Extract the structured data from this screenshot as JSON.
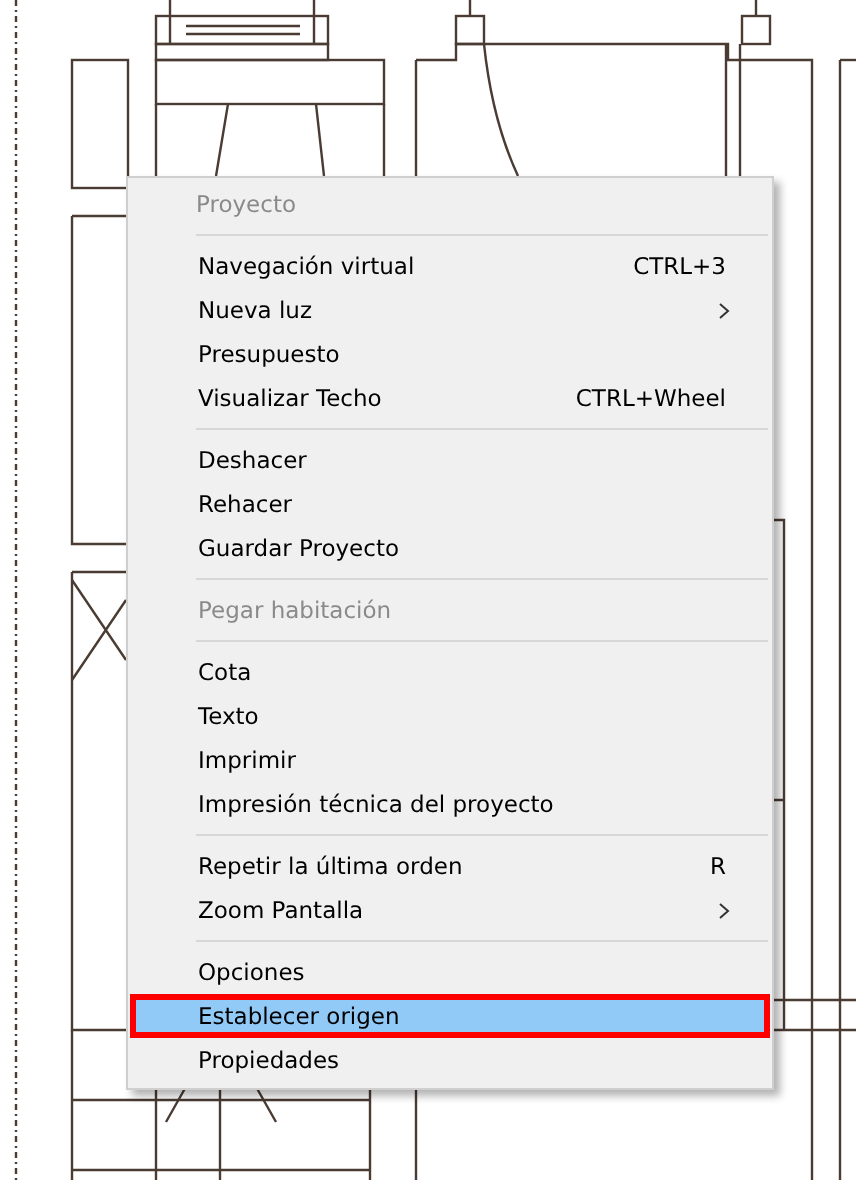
{
  "context_menu": {
    "items": [
      {
        "kind": "header",
        "label": "Proyecto",
        "disabled": true
      },
      {
        "kind": "separator"
      },
      {
        "kind": "item",
        "label": "Navegación virtual",
        "shortcut": "CTRL+3",
        "disabled": false,
        "selected": false
      },
      {
        "kind": "item",
        "label": "Nueva luz",
        "submenu": true,
        "disabled": false,
        "selected": false
      },
      {
        "kind": "item",
        "label": "Presupuesto",
        "disabled": false,
        "selected": false
      },
      {
        "kind": "item",
        "label": "Visualizar Techo",
        "shortcut": "CTRL+Wheel",
        "disabled": false,
        "selected": false
      },
      {
        "kind": "separator"
      },
      {
        "kind": "item",
        "label": "Deshacer",
        "disabled": false,
        "selected": false
      },
      {
        "kind": "item",
        "label": "Rehacer",
        "disabled": false,
        "selected": false
      },
      {
        "kind": "item",
        "label": "Guardar Proyecto",
        "disabled": false,
        "selected": false
      },
      {
        "kind": "separator"
      },
      {
        "kind": "item",
        "label": "Pegar habitación",
        "disabled": true,
        "selected": false
      },
      {
        "kind": "separator"
      },
      {
        "kind": "item",
        "label": "Cota",
        "disabled": false,
        "selected": false
      },
      {
        "kind": "item",
        "label": "Texto",
        "disabled": false,
        "selected": false
      },
      {
        "kind": "item",
        "label": "Imprimir",
        "disabled": false,
        "selected": false
      },
      {
        "kind": "item",
        "label": "Impresión técnica del proyecto",
        "disabled": false,
        "selected": false
      },
      {
        "kind": "separator"
      },
      {
        "kind": "item",
        "label": "Repetir la última orden",
        "shortcut": "R",
        "disabled": false,
        "selected": false
      },
      {
        "kind": "item",
        "label": "Zoom Pantalla",
        "submenu": true,
        "disabled": false,
        "selected": false
      },
      {
        "kind": "separator"
      },
      {
        "kind": "item",
        "label": "Opciones",
        "disabled": false,
        "selected": false
      },
      {
        "kind": "item",
        "label": "Establecer origen",
        "disabled": false,
        "selected": true
      },
      {
        "kind": "item",
        "label": "Propiedades",
        "disabled": false,
        "selected": false
      }
    ]
  }
}
